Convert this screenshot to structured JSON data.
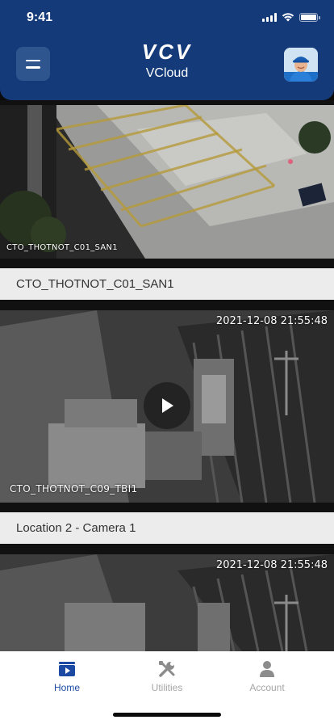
{
  "status_bar": {
    "time": "9:41"
  },
  "header": {
    "logo": "VCV",
    "app_name": "VCloud"
  },
  "cameras": [
    {
      "overlay_name": "CTO_THOTNOT_C01_SAN1",
      "caption": "CTO_THOTNOT_C01_SAN1",
      "timestamp": ""
    },
    {
      "overlay_name": "CTO_THOTNOT_C09_TBI1",
      "caption": "Location 2 - Camera 1",
      "timestamp": "2021-12-08 21:55:48",
      "playing": false
    },
    {
      "overlay_name": "",
      "caption": "",
      "timestamp": "2021-12-08 21:55:48"
    }
  ],
  "tabbar": {
    "items": [
      {
        "label": "Home",
        "icon": "home-video-icon",
        "active": true
      },
      {
        "label": "Utilities",
        "icon": "tools-icon",
        "active": false
      },
      {
        "label": "Account",
        "icon": "person-icon",
        "active": false
      }
    ]
  },
  "colors": {
    "header": "#143a7a",
    "accent": "#1c4aa3",
    "inactive": "#a6a6a6",
    "caption_bg": "#ececec"
  }
}
